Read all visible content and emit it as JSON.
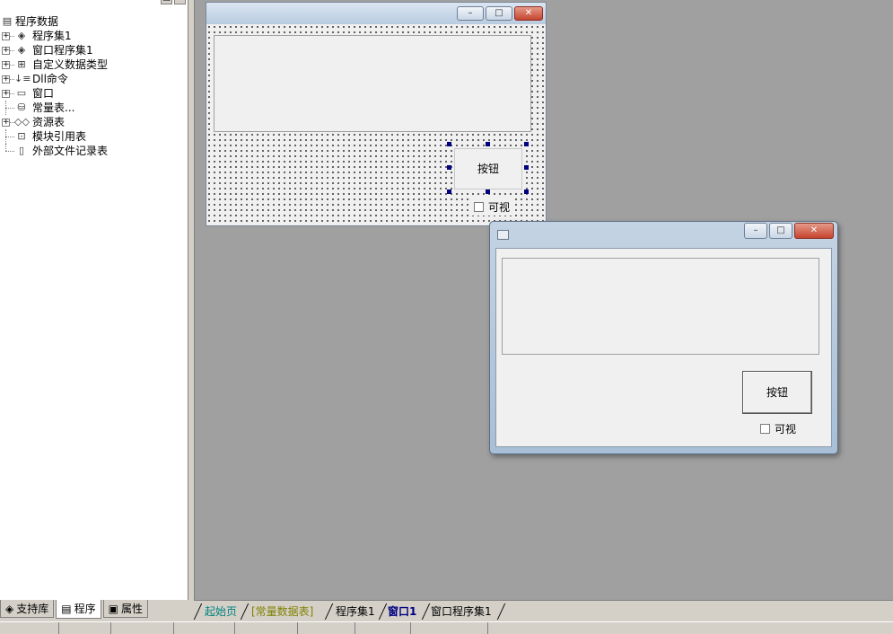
{
  "left_panel": {
    "tree": {
      "root": {
        "label": "程序数据",
        "icon": "data-tree-icon"
      },
      "items": [
        {
          "label": "程序集1",
          "icon": "assembly-icon",
          "expandable": true
        },
        {
          "label": "窗口程序集1",
          "icon": "window-assembly-icon",
          "expandable": true
        },
        {
          "label": "自定义数据类型",
          "icon": "custom-type-icon",
          "expandable": true
        },
        {
          "label": "Dll命令",
          "icon": "dll-command-icon",
          "expandable": true
        },
        {
          "label": "窗口",
          "icon": "window-icon",
          "expandable": true
        },
        {
          "label": "常量表...",
          "icon": "constant-table-icon",
          "expandable": false
        },
        {
          "label": "资源表",
          "icon": "resource-table-icon",
          "expandable": true
        },
        {
          "label": "模块引用表",
          "icon": "module-reference-icon",
          "expandable": false
        },
        {
          "label": "外部文件记录表",
          "icon": "external-file-icon",
          "expandable": false
        }
      ]
    },
    "tabs": [
      {
        "label": "支持库",
        "icon": "library-icon"
      },
      {
        "label": "程序",
        "icon": "program-icon"
      },
      {
        "label": "属性",
        "icon": "properties-icon"
      }
    ]
  },
  "design_window": {
    "button_label": "按钮",
    "checkbox_label": "可视"
  },
  "run_window": {
    "button_label": "按钮",
    "checkbox_label": "可视"
  },
  "doc_tabs": [
    {
      "label": "起始页",
      "color": "#008080"
    },
    {
      "label": "[常量数据表]",
      "color": "#808000"
    },
    {
      "label": "程序集1",
      "color": "#000000"
    },
    {
      "label": "窗口1",
      "color": "#000080",
      "active": true
    },
    {
      "label": "窗口程序集1",
      "color": "#000000"
    }
  ]
}
